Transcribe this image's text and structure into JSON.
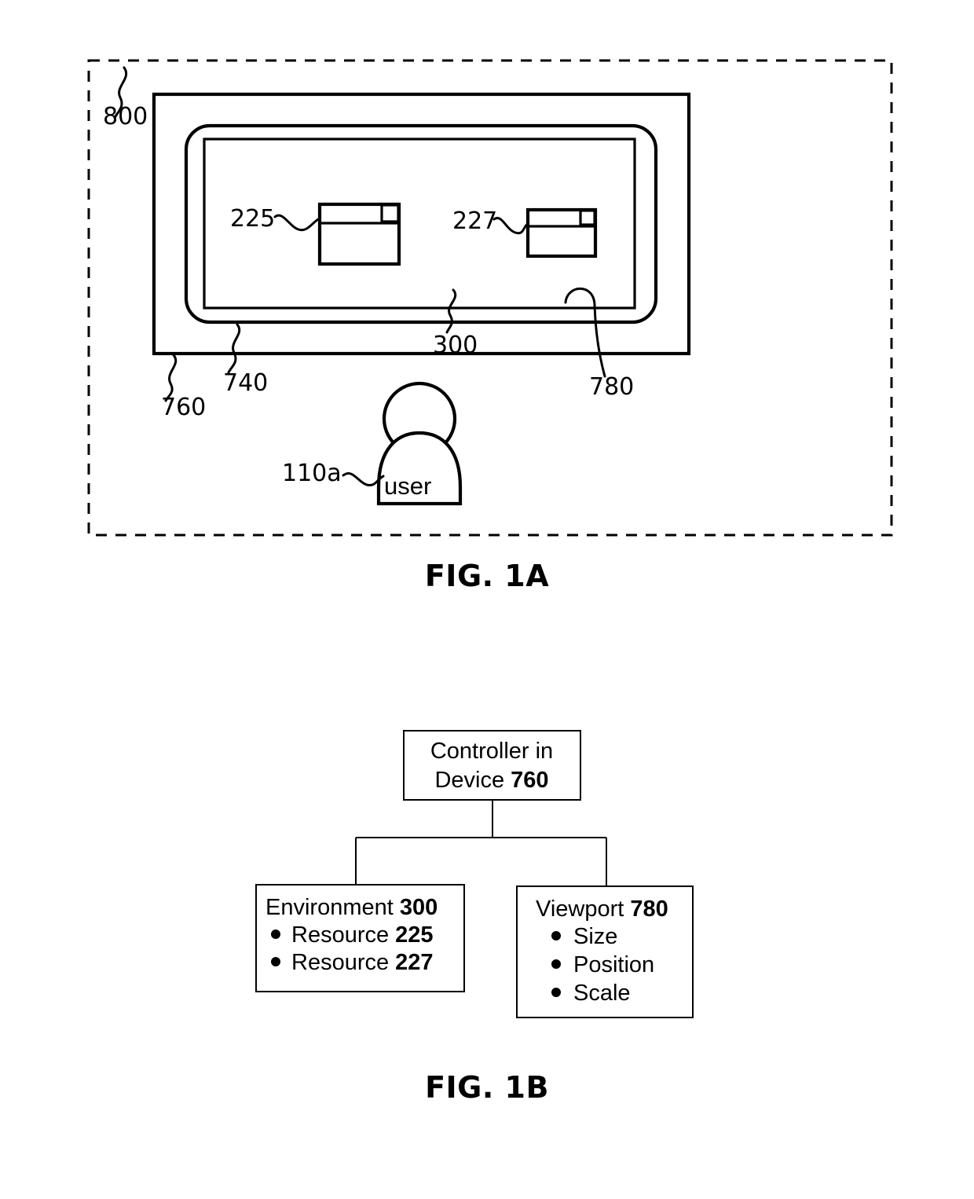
{
  "figures": [
    {
      "id": "fig-1a",
      "caption": "FIG. 1A",
      "labels": {
        "system": "800",
        "device": "760",
        "display": "740",
        "environment": "300",
        "viewport": "780",
        "resource_a": "225",
        "resource_b": "227",
        "user_ref": "110a",
        "user_text": "user"
      }
    },
    {
      "id": "fig-1b",
      "caption": "FIG. 1B",
      "nodes": {
        "controller": {
          "line1": "Controller in",
          "line2_prefix": "Device ",
          "line2_ref": "760"
        },
        "environment": {
          "title_prefix": "Environment ",
          "title_ref": "300",
          "items": [
            {
              "prefix": "Resource ",
              "ref": "225"
            },
            {
              "prefix": "Resource ",
              "ref": "227"
            }
          ]
        },
        "viewport": {
          "title_prefix": "Viewport ",
          "title_ref": "780",
          "items": [
            {
              "prefix": "Size",
              "ref": ""
            },
            {
              "prefix": "Position",
              "ref": ""
            },
            {
              "prefix": "Scale",
              "ref": ""
            }
          ]
        }
      }
    }
  ],
  "colors": {
    "line": "#000000",
    "background": "#ffffff"
  }
}
